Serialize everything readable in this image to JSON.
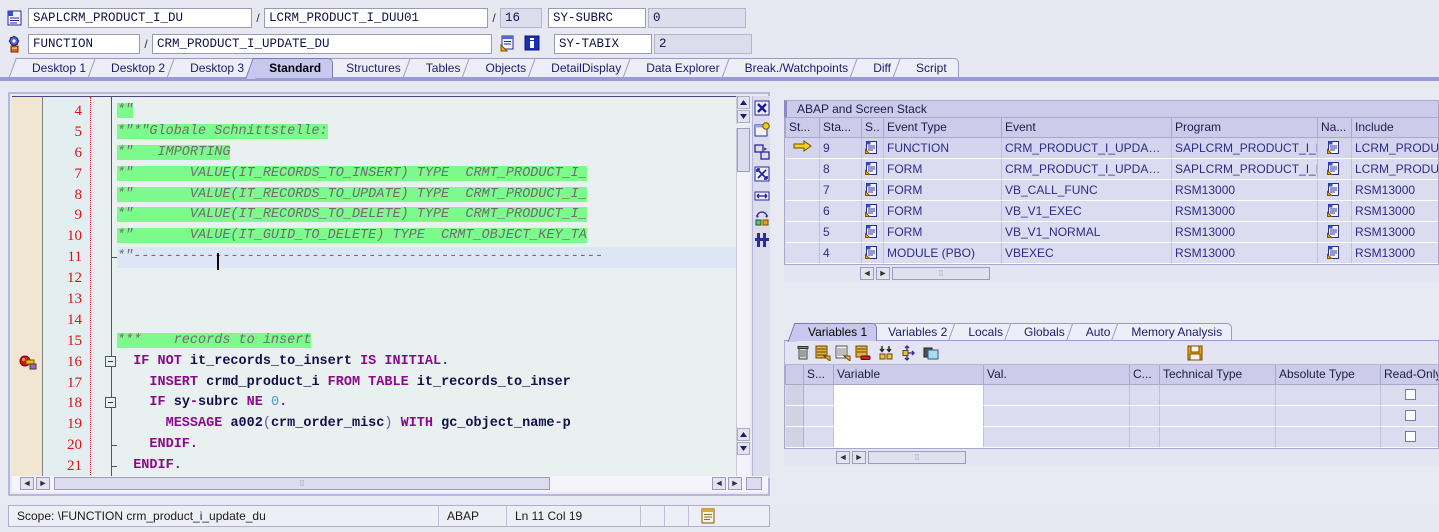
{
  "header": {
    "row1": {
      "icon": "program-icon",
      "program": "SAPLCRM_PRODUCT_I_DU",
      "sep1": "/",
      "include": "LCRM_PRODUCT_I_DUU01",
      "sep2": "/",
      "line": "16",
      "field_label": "SY-SUBRC",
      "field_value": "0"
    },
    "row2": {
      "icon": "debugger-gear-icon",
      "event_type": "FUNCTION",
      "sep1": "/",
      "event_name": "CRM_PRODUCT_I_UPDATE_DU",
      "icon_goto": "goto-source-icon",
      "icon_info": "info-icon",
      "field_label": "SY-TABIX",
      "field_value": "2"
    }
  },
  "tabs": [
    {
      "label": "Desktop 1",
      "active": false
    },
    {
      "label": "Desktop 2",
      "active": false
    },
    {
      "label": "Desktop 3",
      "active": false
    },
    {
      "label": "Standard",
      "active": true
    },
    {
      "label": "Structures",
      "active": false
    },
    {
      "label": "Tables",
      "active": false
    },
    {
      "label": "Objects",
      "active": false
    },
    {
      "label": "DetailDisplay",
      "active": false
    },
    {
      "label": "Data Explorer",
      "active": false
    },
    {
      "label": "Break./Watchpoints",
      "active": false
    },
    {
      "label": "Diff",
      "active": false
    },
    {
      "label": "Script",
      "active": false
    }
  ],
  "editor": {
    "breakpoint_line": 16,
    "cursor_line": 11,
    "lines": [
      {
        "n": "4",
        "segments": [
          {
            "t": "*\"",
            "c": "cmt"
          }
        ]
      },
      {
        "n": "5",
        "segments": [
          {
            "t": "*\"*\"Globale Schnittstelle:",
            "c": "cmt"
          }
        ]
      },
      {
        "n": "6",
        "segments": [
          {
            "t": "*\"   IMPORTING",
            "c": "cmt"
          }
        ]
      },
      {
        "n": "7",
        "segments": [
          {
            "t": "*\"       VALUE(IT_RECORDS_TO_INSERT) TYPE  CRMT_PRODUCT_I_",
            "c": "cmt"
          }
        ]
      },
      {
        "n": "8",
        "segments": [
          {
            "t": "*\"       VALUE(IT_RECORDS_TO_UPDATE) TYPE  CRMT_PRODUCT_I_",
            "c": "cmt"
          }
        ]
      },
      {
        "n": "9",
        "segments": [
          {
            "t": "*\"       VALUE(IT_RECORDS_TO_DELETE) TYPE  CRMT_PRODUCT_I_",
            "c": "cmt"
          }
        ]
      },
      {
        "n": "10",
        "segments": [
          {
            "t": "*\"       VALUE(IT_GUID_TO_DELETE) TYPE  CRMT_OBJECT_KEY_TA",
            "c": "cmt"
          }
        ]
      },
      {
        "n": "11",
        "segments": [
          {
            "t": "*\"----------------------------------------------------------",
            "c": "cmt-plain"
          }
        ]
      },
      {
        "n": "12",
        "segments": []
      },
      {
        "n": "13",
        "segments": []
      },
      {
        "n": "14",
        "segments": []
      },
      {
        "n": "15",
        "segments": [
          {
            "t": "***    records to insert",
            "c": "cmt"
          }
        ]
      },
      {
        "n": "16",
        "segments": [
          {
            "t": "  ",
            "c": ""
          },
          {
            "t": "IF NOT",
            "c": "kw"
          },
          {
            "t": " ",
            "c": ""
          },
          {
            "t": "it_records_to_insert",
            "c": "id"
          },
          {
            "t": " ",
            "c": ""
          },
          {
            "t": "IS INITIAL",
            "c": "kw"
          },
          {
            "t": ".",
            "c": "kw"
          }
        ]
      },
      {
        "n": "17",
        "segments": [
          {
            "t": "    ",
            "c": ""
          },
          {
            "t": "INSERT",
            "c": "kw"
          },
          {
            "t": " ",
            "c": ""
          },
          {
            "t": "crmd_product_i",
            "c": "id"
          },
          {
            "t": " ",
            "c": ""
          },
          {
            "t": "FROM TABLE",
            "c": "kw"
          },
          {
            "t": " ",
            "c": ""
          },
          {
            "t": "it_records_to_inser",
            "c": "id"
          }
        ]
      },
      {
        "n": "18",
        "segments": [
          {
            "t": "    ",
            "c": ""
          },
          {
            "t": "IF",
            "c": "kw"
          },
          {
            "t": " ",
            "c": ""
          },
          {
            "t": "sy",
            "c": "id"
          },
          {
            "t": "-",
            "c": "kw"
          },
          {
            "t": "subrc",
            "c": "id"
          },
          {
            "t": " ",
            "c": ""
          },
          {
            "t": "NE",
            "c": "kw"
          },
          {
            "t": " ",
            "c": ""
          },
          {
            "t": "0",
            "c": "num"
          },
          {
            "t": ".",
            "c": "kw"
          }
        ]
      },
      {
        "n": "19",
        "segments": [
          {
            "t": "      ",
            "c": ""
          },
          {
            "t": "MESSAGE",
            "c": "kw"
          },
          {
            "t": " ",
            "c": ""
          },
          {
            "t": "a002",
            "c": "id"
          },
          {
            "t": "(",
            "c": "par"
          },
          {
            "t": "crm_order_misc",
            "c": "id"
          },
          {
            "t": ")",
            "c": "par"
          },
          {
            "t": " ",
            "c": ""
          },
          {
            "t": "WITH",
            "c": "kw"
          },
          {
            "t": " ",
            "c": ""
          },
          {
            "t": "gc_object_name",
            "c": "id"
          },
          {
            "t": "-",
            "c": "kw"
          },
          {
            "t": "p",
            "c": "id"
          }
        ]
      },
      {
        "n": "20",
        "segments": [
          {
            "t": "    ",
            "c": ""
          },
          {
            "t": "ENDIF.",
            "c": "kw"
          }
        ]
      },
      {
        "n": "21",
        "segments": [
          {
            "t": "  ",
            "c": ""
          },
          {
            "t": "ENDIF.",
            "c": "kw"
          }
        ]
      }
    ],
    "toolbar_icons": [
      "close-view-icon",
      "new-window-icon",
      "detach-window-icon",
      "maximize-icon",
      "resize-width-icon",
      "swap-colors-icon",
      "settings-layout-icon"
    ]
  },
  "stack_panel": {
    "title": "ABAP and Screen Stack",
    "columns": [
      "St...",
      "Sta...",
      "S..",
      "Event Type",
      "Event",
      "Program",
      "Na...",
      "Include"
    ],
    "rows": [
      {
        "cur": true,
        "stack": "9",
        "event_type": "FUNCTION",
        "event": "CRM_PRODUCT_I_UPDA…",
        "program": "SAPLCRM_PRODUCT_I_D…",
        "include": "LCRM_PRODUCT_I_DUU"
      },
      {
        "cur": false,
        "stack": "8",
        "event_type": "FORM",
        "event": "CRM_PRODUCT_I_UPDA…",
        "program": "SAPLCRM_PRODUCT_I_D…",
        "include": "LCRM_PRODUCT_I_DUU"
      },
      {
        "cur": false,
        "stack": "7",
        "event_type": "FORM",
        "event": "VB_CALL_FUNC",
        "program": "RSM13000",
        "include": "RSM13000"
      },
      {
        "cur": false,
        "stack": "6",
        "event_type": "FORM",
        "event": "VB_V1_EXEC",
        "program": "RSM13000",
        "include": "RSM13000"
      },
      {
        "cur": false,
        "stack": "5",
        "event_type": "FORM",
        "event": "VB_V1_NORMAL",
        "program": "RSM13000",
        "include": "RSM13000"
      },
      {
        "cur": false,
        "stack": "4",
        "event_type": "MODULE (PBO)",
        "event": "VBEXEC",
        "program": "RSM13000",
        "include": "RSM13000"
      }
    ]
  },
  "variables_panel": {
    "tabs": [
      {
        "label": "Variables 1",
        "active": true
      },
      {
        "label": "Variables 2",
        "active": false
      },
      {
        "label": "Locals",
        "active": false
      },
      {
        "label": "Globals",
        "active": false
      },
      {
        "label": "Auto",
        "active": false
      },
      {
        "label": "Memory Analysis",
        "active": false
      }
    ],
    "toolbar_icons": [
      "delete-icon",
      "insert-row-icon",
      "copy-rows-icon",
      "delete-row-icon",
      "sort-icon",
      "expand-icon",
      "paste-icon",
      "save-icon"
    ],
    "columns": [
      "S...",
      "Variable",
      "Val.",
      "C...",
      "Technical Type",
      "Absolute Type",
      "Read-Only..."
    ],
    "rows": [
      {
        "variable": "",
        "value": "",
        "c": "",
        "technical_type": "",
        "absolute_type": "",
        "read_only": false
      },
      {
        "variable": "",
        "value": "",
        "c": "",
        "technical_type": "",
        "absolute_type": "",
        "read_only": false
      },
      {
        "variable": "",
        "value": "",
        "c": "",
        "technical_type": "",
        "absolute_type": "",
        "read_only": false
      }
    ]
  },
  "statusbar": {
    "scope": "Scope: \\FUNCTION crm_product_i_update_du",
    "language": "ABAP",
    "position": "Ln  11 Col  19",
    "icon": "editor-status-icon"
  }
}
